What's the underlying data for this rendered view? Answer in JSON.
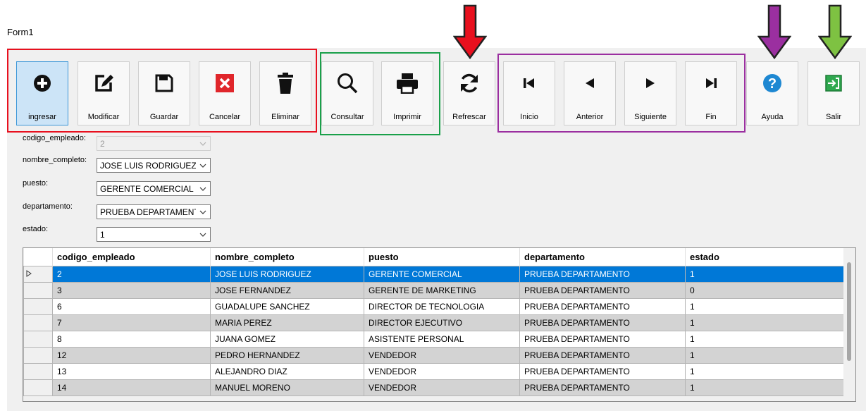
{
  "window": {
    "title": "Form1"
  },
  "toolbar": [
    {
      "name": "ingresar-button",
      "icon": "plus-circle-icon",
      "label": "ingresar",
      "active": true
    },
    {
      "name": "modificar-button",
      "icon": "edit-icon",
      "label": "Modificar"
    },
    {
      "name": "guardar-button",
      "icon": "save-icon",
      "label": "Guardar"
    },
    {
      "name": "cancelar-button",
      "icon": "cancel-icon",
      "label": "Cancelar"
    },
    {
      "name": "eliminar-button",
      "icon": "trash-icon",
      "label": "Eliminar"
    },
    {
      "name": "consultar-button",
      "icon": "search-icon",
      "label": "Consultar"
    },
    {
      "name": "imprimir-button",
      "icon": "printer-icon",
      "label": "Imprimir"
    },
    {
      "name": "refrescar-button",
      "icon": "refresh-icon",
      "label": "Refrescar"
    },
    {
      "name": "inicio-button",
      "icon": "first-icon",
      "label": "Inicio"
    },
    {
      "name": "anterior-button",
      "icon": "prev-icon",
      "label": "Anterior"
    },
    {
      "name": "siguiente-button",
      "icon": "next-icon",
      "label": "Siguiente"
    },
    {
      "name": "fin-button",
      "icon": "last-icon",
      "label": "Fin"
    },
    {
      "name": "ayuda-button",
      "icon": "help-icon",
      "label": "Ayuda"
    },
    {
      "name": "salir-button",
      "icon": "exit-icon",
      "label": "Salir"
    }
  ],
  "form": {
    "fields": [
      {
        "label": "codigo_empleado:",
        "value": "2",
        "enabled": false
      },
      {
        "label": "nombre_completo:",
        "value": "JOSE LUIS RODRIGUEZ"
      },
      {
        "label": "puesto:",
        "value": "GERENTE COMERCIAL"
      },
      {
        "label": "departamento:",
        "value": "PRUEBA DEPARTAMENTO"
      },
      {
        "label": "estado:",
        "value": "1"
      }
    ]
  },
  "grid": {
    "columns": [
      "codigo_empleado",
      "nombre_completo",
      "puesto",
      "departamento",
      "estado"
    ],
    "rows": [
      [
        "2",
        "JOSE LUIS RODRIGUEZ",
        "GERENTE COMERCIAL",
        "PRUEBA DEPARTAMENTO",
        "1"
      ],
      [
        "3",
        "JOSE FERNANDEZ",
        "GERENTE DE MARKETING",
        "PRUEBA DEPARTAMENTO",
        "0"
      ],
      [
        "6",
        "GUADALUPE SANCHEZ",
        "DIRECTOR DE TECNOLOGIA",
        "PRUEBA DEPARTAMENTO",
        "1"
      ],
      [
        "7",
        "MARIA PEREZ",
        "DIRECTOR EJECUTIVO",
        "PRUEBA DEPARTAMENTO",
        "1"
      ],
      [
        "8",
        "JUANA GOMEZ",
        "ASISTENTE PERSONAL",
        "PRUEBA DEPARTAMENTO",
        "1"
      ],
      [
        "12",
        "PEDRO HERNANDEZ",
        "VENDEDOR",
        "PRUEBA DEPARTAMENTO",
        "1"
      ],
      [
        "13",
        "ALEJANDRO DIAZ",
        "VENDEDOR",
        "PRUEBA DEPARTAMENTO",
        "1"
      ],
      [
        "14",
        "MANUEL MORENO",
        "VENDEDOR",
        "PRUEBA DEPARTAMENTO",
        "1"
      ]
    ]
  },
  "annotations": {
    "groups": [
      {
        "name": "edit-group-outline",
        "color": "#e8101e"
      },
      {
        "name": "query-group-outline",
        "color": "#1aa04a"
      },
      {
        "name": "navigation-group-outline",
        "color": "#9b2fa0"
      }
    ],
    "arrows": [
      {
        "name": "refrescar-arrow",
        "color": "#e8101e"
      },
      {
        "name": "ayuda-arrow",
        "color": "#9b2fa0"
      },
      {
        "name": "salir-arrow",
        "color": "#7ec242"
      }
    ]
  },
  "colors": {
    "selection": "#0078d7",
    "alt_row": "#d3d3d3",
    "help_icon": "#1e88d2",
    "exit_icon": "#2fa84f",
    "cancel_icon": "#e0262b"
  }
}
